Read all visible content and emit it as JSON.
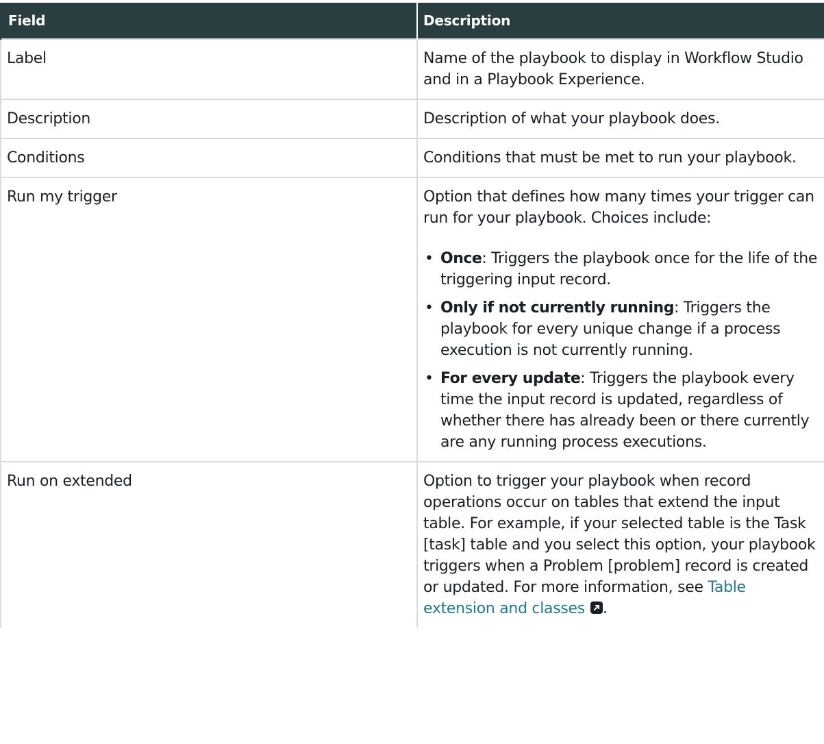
{
  "table": {
    "headers": [
      "Field",
      "Description"
    ],
    "rows": [
      {
        "field": "Label",
        "description": "Name of the playbook to display in Workflow Studio and in a Playbook Experience."
      },
      {
        "field": "Description",
        "description": "Description of what your playbook does."
      },
      {
        "field": "Conditions",
        "description": "Conditions that must be met to run your playbook."
      },
      {
        "field": "Run my trigger",
        "description": "Option that defines how many times your trigger can run for your playbook. Choices include:",
        "options": [
          {
            "term": "Once",
            "text": ": Triggers the playbook once for the life of the triggering input record."
          },
          {
            "term": "Only if not currently running",
            "text": ": Triggers the playbook for every unique change if a process execution is not currently running."
          },
          {
            "term": "For every update",
            "text": ": Triggers the playbook every time the input record is updated, regardless of whether there has already been or there currently are any running process executions."
          }
        ]
      },
      {
        "field": "Run on extended",
        "description": "Option to trigger your playbook when record operations occur on tables that extend the input table. For example, if your selected table is the Task [task] table and you select this option, your playbook triggers when a Problem [problem] record is created or updated. For more information, see ",
        "link_text": "Table extension and classes",
        "trailing": "."
      }
    ]
  },
  "icons": {
    "external_link": "external-link-icon"
  },
  "colors": {
    "header_bg": "#293e40",
    "link": "#1f7a8c",
    "border": "#d8dcdf"
  }
}
